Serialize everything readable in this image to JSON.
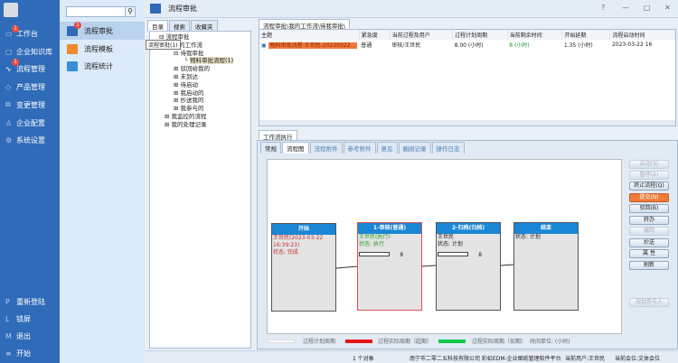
{
  "nav": {
    "items": [
      {
        "label": "工作台",
        "badge": "1"
      },
      {
        "label": "企业知识库"
      },
      {
        "label": "流程管理",
        "badge": "1"
      },
      {
        "label": "产品管理"
      },
      {
        "label": "变更管理"
      },
      {
        "label": "企业配置"
      },
      {
        "label": "系统设置"
      }
    ],
    "bottom": [
      {
        "key": "P",
        "label": "重新登陆"
      },
      {
        "key": "L",
        "label": "锁屏"
      },
      {
        "key": "M",
        "label": "退出"
      },
      {
        "key": "≡",
        "label": "开始"
      }
    ]
  },
  "sub": {
    "search_placeholder": "",
    "items": [
      {
        "label": "流程审批",
        "badge": "1"
      },
      {
        "label": "流程模板"
      },
      {
        "label": "流程统计"
      }
    ]
  },
  "title": "流程审批",
  "tree": {
    "tabs": [
      "目录",
      "搜索",
      "收藏夹"
    ],
    "tooltip": "流程审批(1)",
    "nodes": [
      "流程审批",
      "我的工作流",
      "待我审批",
      "物料审批流程(1)",
      "驳回给我的",
      "未到达",
      "待启动",
      "我启动的",
      "抄送我的",
      "我参与的",
      "我监控的流程",
      "我的处理记录"
    ]
  },
  "grid": {
    "tab": "流程审批\\我的工作流\\待我审批\\",
    "columns": [
      "主题",
      "紧急度",
      "当前过程及用户",
      "过程计划周期",
      "当前剩余时间",
      "开始延期",
      "流程启动时间"
    ],
    "rows": [
      [
        "物料审批流程-王世民-20230322...",
        "普通",
        "审核/王世民",
        "8.00 (小时)",
        "8 (小时)",
        "1.35 (小时)",
        "2023-03-22 16"
      ]
    ]
  },
  "exec": {
    "title": "工作流执行",
    "tabs": [
      "常规",
      "流程图",
      "流程附件",
      "参考附件",
      "意见",
      "圈阅记录",
      "操作日志"
    ],
    "nodes": [
      {
        "title": "开始",
        "lines": [
          "王世民(2023-03-22",
          "16:39:23)",
          "状态: 完成"
        ]
      },
      {
        "title": "1-审核(普通)",
        "lines": [
          "王世民(执行)",
          "状态: 执行"
        ],
        "count": "8"
      },
      {
        "title": "2-归档(归档)",
        "lines": [
          "王世民",
          "状态: 计划"
        ],
        "count": "8"
      },
      {
        "title": "结束",
        "lines": [
          "状态: 计划"
        ]
      }
    ],
    "buttons": [
      "启动(S)",
      "暂停(X)",
      "终止流程(Q)",
      "提交(N)",
      "驳回(B)",
      "转办",
      "撤回",
      "抄送",
      "属 性",
      "刷新"
    ],
    "plan_button": "规划参与人",
    "legend": [
      {
        "label": "过程计划周期",
        "color": "#ffffff"
      },
      {
        "label": "过程实际周期（超期）",
        "color": "#e8141c"
      },
      {
        "label": "过程实际周期（如期）",
        "color": "#12c84a"
      }
    ],
    "unit": "时间单位: (小时)"
  },
  "status": {
    "count": "1 个对象",
    "company": "南宁市二零二五科技有限公司 彩虹EDM-企业图纸管理软件平台",
    "user": "当前用户:王世民",
    "unit": "当前会位:文体会位"
  }
}
